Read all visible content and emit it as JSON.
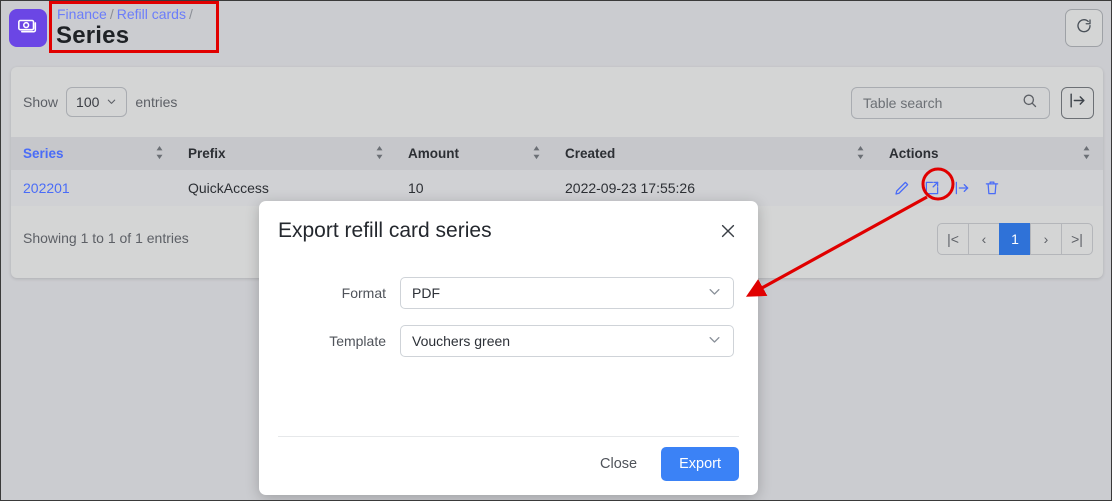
{
  "app": {
    "logo_icon": "banknote-icon",
    "refresh_icon": "refresh-icon"
  },
  "breadcrumb": {
    "items": [
      "Finance",
      "Refill cards"
    ],
    "separator": "/",
    "trailing_separator": "/"
  },
  "header": {
    "title": "Series"
  },
  "toolbar": {
    "show_label": "Show",
    "entries_value": "100",
    "entries_label": "entries",
    "search_placeholder": "Table search",
    "search_value": "",
    "search_icon": "search-icon",
    "export_all_icon": "export-arrow-icon"
  },
  "table": {
    "columns": [
      {
        "label": "Series",
        "sorted": true
      },
      {
        "label": "Prefix",
        "sorted": false
      },
      {
        "label": "Amount",
        "sorted": false
      },
      {
        "label": "Created",
        "sorted": false
      },
      {
        "label": "Actions",
        "sorted": false
      }
    ],
    "rows": [
      {
        "series": "202201",
        "prefix": "QuickAccess",
        "amount": "10",
        "created": "2022-09-23 17:55:26",
        "actions": [
          "edit-icon",
          "open-external-icon",
          "export-arrow-icon",
          "delete-icon"
        ]
      }
    ]
  },
  "footer": {
    "entries_info": "Showing 1 to 1 of 1 entries",
    "pagination": {
      "first": "|<",
      "prev": "‹",
      "pages": [
        "1"
      ],
      "current": "1",
      "next": "›",
      "last": ">|"
    }
  },
  "modal": {
    "title": "Export refill card series",
    "close_icon": "close-icon",
    "fields": [
      {
        "label": "Format",
        "value": "PDF"
      },
      {
        "label": "Template",
        "value": "Vouchers green"
      }
    ],
    "close_label": "Close",
    "export_label": "Export"
  },
  "annotations": {
    "highlight_color": "#e10000",
    "arrow_color": "#e00000",
    "title_box": "Series",
    "circled_action": "export-arrow-icon"
  },
  "colors": {
    "accent_blue": "#3b82f6",
    "link_blue": "#4a6cf7",
    "brand_purple": "#6b46e5",
    "page_bg": "#cbccd0",
    "card_bg": "#d4d5d5"
  }
}
